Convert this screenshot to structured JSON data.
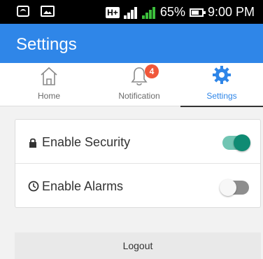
{
  "status_bar": {
    "network_type": "H+",
    "battery_percent": "65%",
    "time": "9:00 PM"
  },
  "app_bar": {
    "title": "Settings"
  },
  "tabs": [
    {
      "label": "Home",
      "icon": "home-icon"
    },
    {
      "label": "Notification",
      "icon": "bell-icon",
      "badge": "4"
    },
    {
      "label": "Settings",
      "icon": "gear-icon"
    }
  ],
  "settings": {
    "items": [
      {
        "label": "Enable Security",
        "icon": "lock-icon",
        "enabled": true
      },
      {
        "label": "Enable Alarms",
        "icon": "alarm-icon",
        "enabled": false
      }
    ]
  },
  "logout_label": "Logout",
  "colors": {
    "app_bar": "#2f86e8",
    "active_tab": "#2f86e8",
    "badge": "#f0573a",
    "toggle_on_track": "#71c5b3",
    "toggle_on_knob": "#0f8b73",
    "toggle_off_track": "#8e8e8e"
  }
}
